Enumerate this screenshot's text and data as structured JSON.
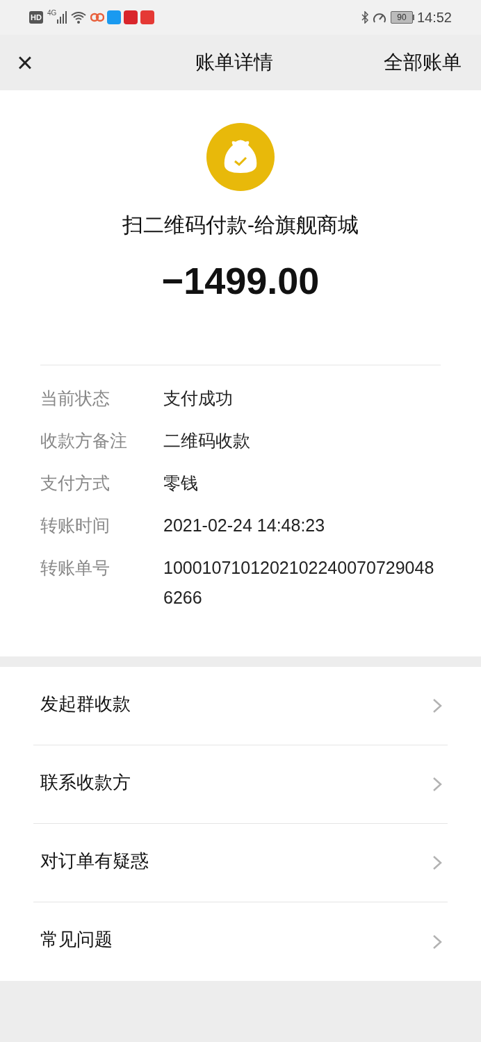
{
  "status_bar": {
    "hd": "HD",
    "network": "4G",
    "battery": "90",
    "time": "14:52"
  },
  "nav": {
    "close": "×",
    "title": "账单详情",
    "action": "全部账单"
  },
  "bill": {
    "title": "扫二维码付款-给旗舰商城",
    "amount": "−1499.00"
  },
  "details": [
    {
      "label": "当前状态",
      "value": "支付成功"
    },
    {
      "label": "收款方备注",
      "value": "二维码收款"
    },
    {
      "label": "支付方式",
      "value": "零钱"
    },
    {
      "label": "转账时间",
      "value": "2021-02-24 14:48:23"
    },
    {
      "label": "转账单号",
      "value": "10001071012021022400707290486266"
    }
  ],
  "actions": [
    {
      "label": "发起群收款"
    },
    {
      "label": "联系收款方"
    },
    {
      "label": "对订单有疑惑"
    },
    {
      "label": "常见问题"
    }
  ]
}
